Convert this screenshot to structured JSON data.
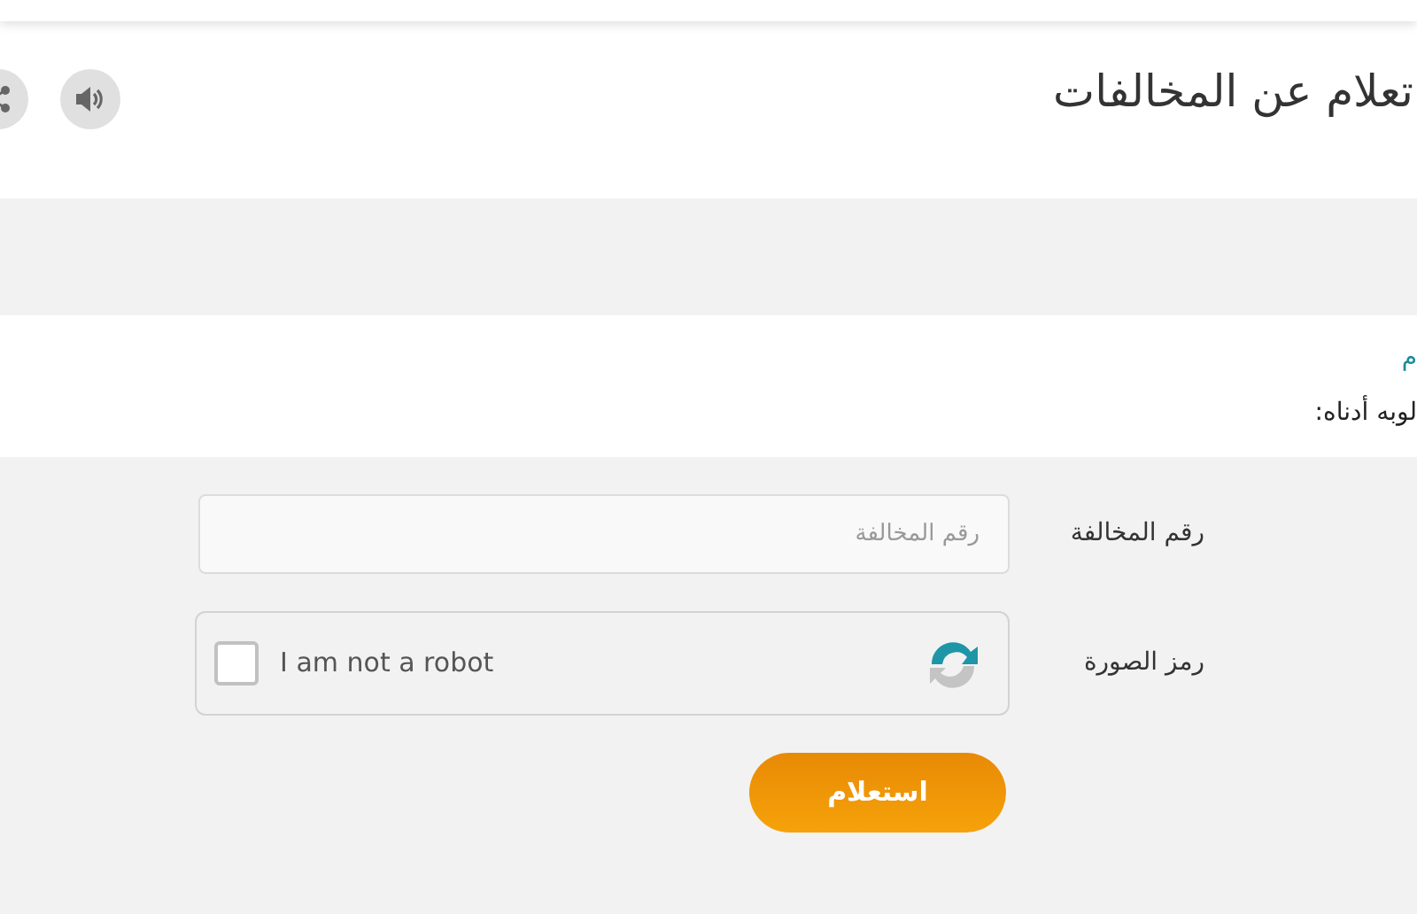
{
  "page_title": "تعلام عن المخالفات",
  "intro": {
    "link": "م",
    "text": "لوبه أدناه:"
  },
  "fields": [
    {
      "kind": "text",
      "label": "رقم المخالفة",
      "placeholder": "رقم المخالفة"
    },
    {
      "kind": "captcha",
      "label": "رمز الصورة",
      "checkbox_label": "I am not a robot",
      "checked": false
    }
  ],
  "submit": "استعلام"
}
